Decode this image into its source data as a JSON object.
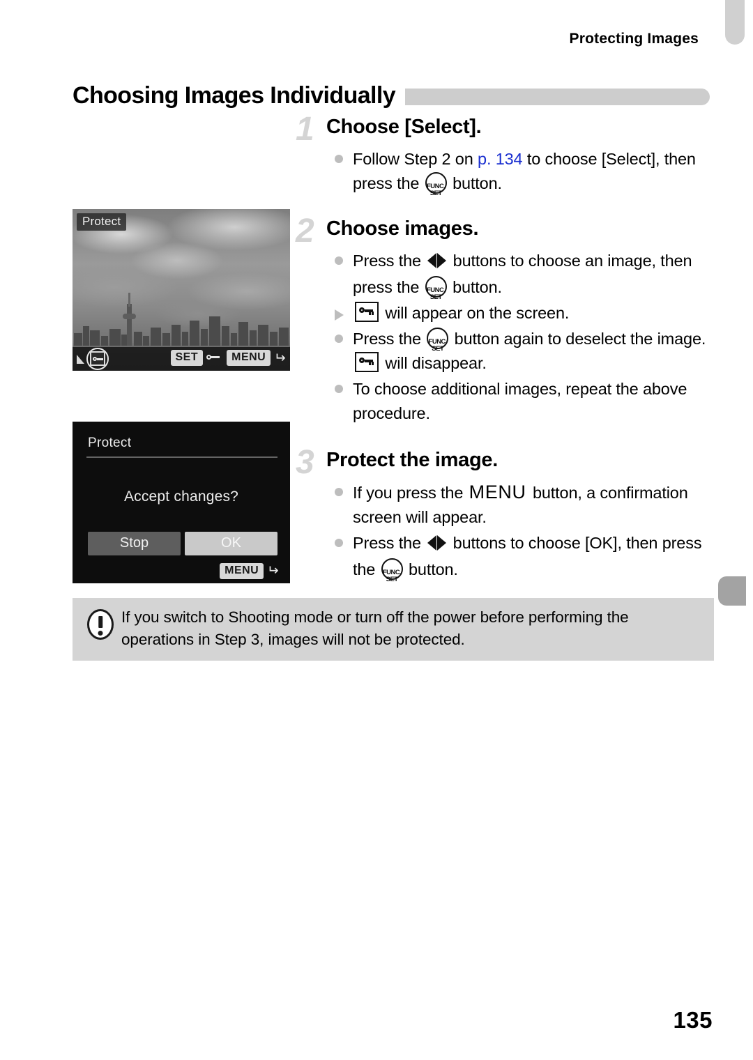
{
  "header": {
    "running_head": "Protecting Images",
    "section_title": "Choosing Images Individually"
  },
  "steps": [
    {
      "number": "1",
      "title": "Choose [Select].",
      "bullets": [
        {
          "marker": "dot",
          "parts": [
            {
              "type": "text",
              "value": "Follow Step 2 on "
            },
            {
              "type": "link",
              "value": "p. 134"
            },
            {
              "type": "text",
              "value": " to choose [Select], then press the "
            },
            {
              "type": "icon",
              "value": "func-set-icon"
            },
            {
              "type": "text",
              "value": " button."
            }
          ]
        }
      ]
    },
    {
      "number": "2",
      "title": "Choose images.",
      "bullets": [
        {
          "marker": "dot",
          "parts": [
            {
              "type": "text",
              "value": "Press the "
            },
            {
              "type": "icon",
              "value": "left-right-arrows-icon"
            },
            {
              "type": "text",
              "value": " buttons to choose an image, then press the "
            },
            {
              "type": "icon",
              "value": "func-set-icon"
            },
            {
              "type": "text",
              "value": " button."
            }
          ]
        },
        {
          "marker": "triangle",
          "parts": [
            {
              "type": "icon",
              "value": "protect-key-icon"
            },
            {
              "type": "text",
              "value": " will appear on the screen."
            }
          ]
        },
        {
          "marker": "dot",
          "parts": [
            {
              "type": "text",
              "value": "Press the "
            },
            {
              "type": "icon",
              "value": "func-set-icon"
            },
            {
              "type": "text",
              "value": " button again to deselect the image. "
            },
            {
              "type": "icon",
              "value": "protect-key-icon"
            },
            {
              "type": "text",
              "value": " will disappear."
            }
          ]
        },
        {
          "marker": "dot",
          "parts": [
            {
              "type": "text",
              "value": "To choose additional images, repeat the above procedure."
            }
          ]
        }
      ]
    },
    {
      "number": "3",
      "title": "Protect the image.",
      "bullets": [
        {
          "marker": "dot",
          "parts": [
            {
              "type": "text",
              "value": "If you press the "
            },
            {
              "type": "icon",
              "value": "menu-word-icon"
            },
            {
              "type": "text",
              "value": " button, a confirmation screen will appear."
            }
          ]
        },
        {
          "marker": "dot",
          "parts": [
            {
              "type": "text",
              "value": "Press the "
            },
            {
              "type": "icon",
              "value": "left-right-arrows-icon"
            },
            {
              "type": "text",
              "value": " buttons to choose [OK], then press the "
            },
            {
              "type": "icon",
              "value": "func-set-icon"
            },
            {
              "type": "text",
              "value": " button."
            }
          ]
        }
      ]
    }
  ],
  "figures": {
    "photo_screen": {
      "label": "Protect",
      "bottom_bar": {
        "set_pill": "SET",
        "set_action_icon": "protect-key-icon",
        "menu_pill": "MENU",
        "back_icon": "back-arrow-icon",
        "selected_icon": "protect-key-selected-icon"
      }
    },
    "confirm_screen": {
      "title": "Protect",
      "question": "Accept changes?",
      "button_stop": "Stop",
      "button_ok": "OK",
      "menu_pill": "MENU",
      "back_icon": "back-arrow-icon"
    }
  },
  "note": {
    "icon": "exclamation-icon",
    "text": "If you switch to Shooting mode or turn off the power before performing the operations in Step 3, images will not be protected."
  },
  "footer": {
    "page_number": "135"
  },
  "icon_glyphs": {
    "func_top": "FUNC.",
    "func_bottom": "SET",
    "menu_word": "MENU"
  },
  "colors": {
    "link": "#1a2fd0",
    "title_bar": "#cdcdcd",
    "step_number": "#d4d4d4",
    "note_bg": "#d4d4d4",
    "tab_top": "#d0d0d0",
    "tab_mid": "#a3a3a3"
  }
}
